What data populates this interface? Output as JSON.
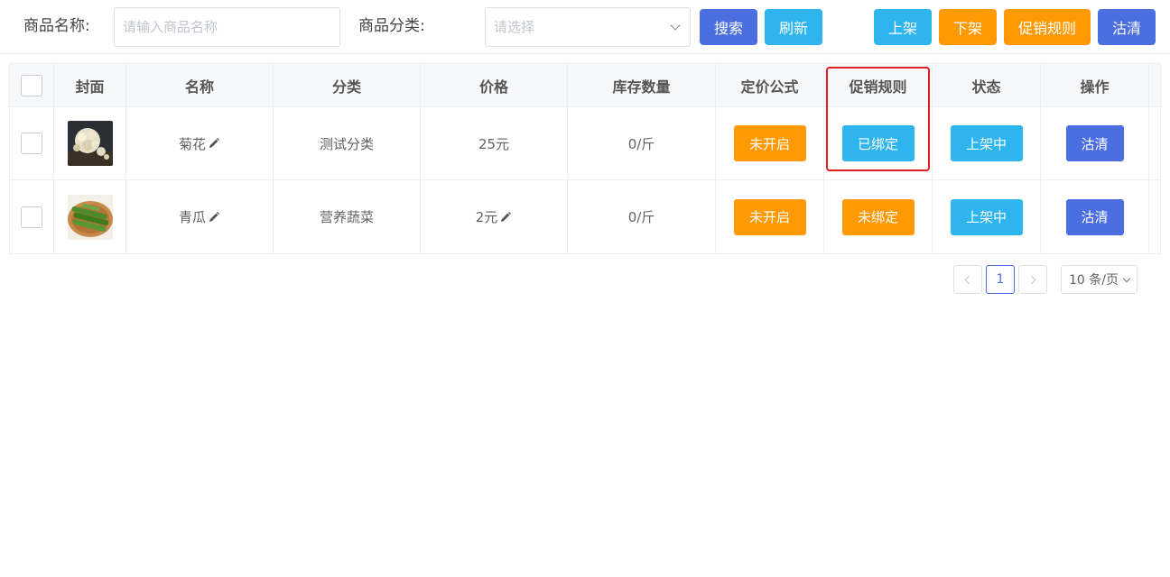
{
  "filters": {
    "name_label": "商品名称:",
    "name_placeholder": "请输入商品名称",
    "category_label": "商品分类:",
    "category_placeholder": "请选择"
  },
  "toolbar": {
    "search": "搜索",
    "refresh": "刷新",
    "list_on": "上架",
    "list_off": "下架",
    "promo_rules": "促销规则",
    "clear": "沽清"
  },
  "table": {
    "headers": [
      "封面",
      "名称",
      "分类",
      "价格",
      "库存数量",
      "定价公式",
      "促销规则",
      "状态",
      "操作"
    ],
    "rows": [
      {
        "name": "菊花",
        "category": "测试分类",
        "price": "25元",
        "stock": "0/斤",
        "formula": "未开启",
        "promo": "已绑定",
        "status": "上架中",
        "action": "沽清"
      },
      {
        "name": "青瓜",
        "category": "营养蔬菜",
        "price": "2元",
        "stock": "0/斤",
        "formula": "未开启",
        "promo": "未绑定",
        "status": "上架中",
        "action": "沽清"
      }
    ]
  },
  "pagination": {
    "current_page": "1",
    "page_size": "10 条/页"
  },
  "colors": {
    "primary_blue": "#4b6fe0",
    "cyan": "#2eb4ef",
    "orange": "#ff9a05",
    "highlight_red": "#e02020"
  }
}
